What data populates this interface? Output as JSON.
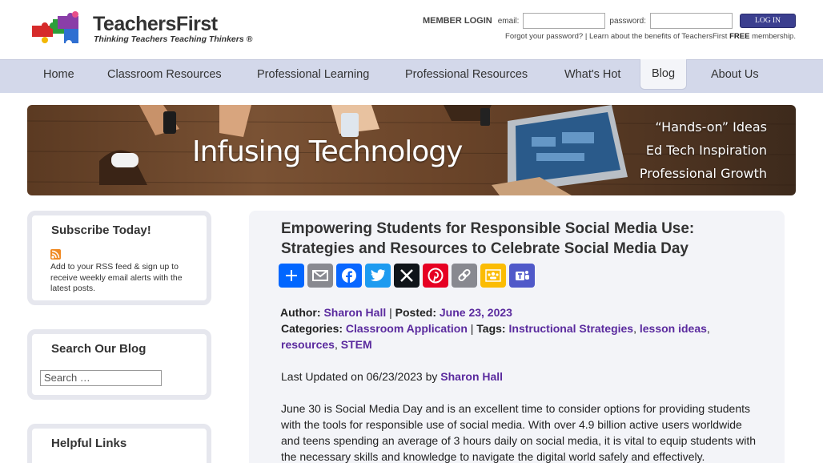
{
  "header": {
    "logo_title": "TeachersFirst",
    "logo_tagline": "Thinking Teachers Teaching Thinkers ®",
    "login": {
      "title": "MEMBER LOGIN",
      "email_label": "email:",
      "password_label": "password:",
      "button_label": "LOG IN",
      "forgot_link": "Forgot your password?",
      "separator": " |  ",
      "benefits_prefix": "Learn about the benefits of TeachersFirst ",
      "benefits_bold": "FREE",
      "benefits_suffix": " membership."
    }
  },
  "nav": {
    "items": [
      {
        "label": "Home"
      },
      {
        "label": "Classroom Resources"
      },
      {
        "label": "Professional Learning"
      },
      {
        "label": "Professional Resources"
      },
      {
        "label": "What's Hot"
      },
      {
        "label": "Blog",
        "active": true
      },
      {
        "label": "About Us"
      }
    ]
  },
  "banner": {
    "title": "Infusing Technology",
    "taglines": [
      "“Hands-on” Ideas",
      "Ed Tech Inspiration",
      "Professional Growth"
    ]
  },
  "sidebar": {
    "subscribe_title": "Subscribe Today!",
    "subscribe_text": "Add to your RSS feed & sign up to receive weekly email alerts with the latest posts.",
    "search_title": "Search Our Blog",
    "search_placeholder": "Search …",
    "helpful_title": "Helpful Links"
  },
  "post": {
    "title": "Empowering Students for Responsible Social Media Use: Strategies and Resources to Celebrate Social Media Day",
    "share_buttons": [
      {
        "icon": "share-icon",
        "label": "Share",
        "color": "#0166ff"
      },
      {
        "icon": "email-icon",
        "label": "Email",
        "color": "#888990"
      },
      {
        "icon": "facebook-icon",
        "label": "Facebook",
        "color": "#0866ff"
      },
      {
        "icon": "twitter-icon",
        "label": "Twitter",
        "color": "#1d9bf0"
      },
      {
        "icon": "x-icon",
        "label": "X",
        "color": "#0f1419"
      },
      {
        "icon": "pinterest-icon",
        "label": "Pinterest",
        "color": "#e60023"
      },
      {
        "icon": "copy-link-icon",
        "label": "Copy Link",
        "color": "#888990"
      },
      {
        "icon": "google-classroom-icon",
        "label": "Google Classroom",
        "color": "#fbbc04"
      },
      {
        "icon": "teams-icon",
        "label": "Teams",
        "color": "#5059c9"
      }
    ],
    "author_label": "Author:",
    "author": "Sharon Hall",
    "posted_label": "Posted:",
    "posted_date": "June 23, 2023",
    "categories_label": "Categories:",
    "category": "Classroom Application",
    "tags_label": "Tags:",
    "tags": [
      "Instructional Strategies",
      "lesson ideas",
      "resources",
      "STEM"
    ],
    "updated_prefix": "Last Updated on 06/23/2023 by",
    "updated_by": "Sharon Hall",
    "body": "June 30 is Social Media Day and is an excellent time to consider options for providing students with the tools for responsible use of social media. With over 4.9 billion active users worldwide and teens spending an average of 3 hours daily on social media, it is vital to equip students with the necessary skills and knowledge to navigate the digital world safely and effectively."
  },
  "colors": {
    "nav_bg": "#d3d8ea",
    "link": "#5a2a9e",
    "login_button": "#3b3f8f"
  }
}
